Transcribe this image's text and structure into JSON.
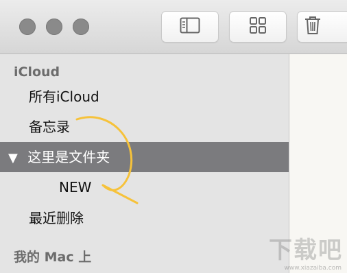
{
  "window": {
    "toolbar": {
      "sidebar_toggle_icon": "sidebar-icon",
      "gallery_icon": "grid-icon",
      "delete_icon": "trash-icon"
    }
  },
  "sidebar": {
    "icloud_section": "iCloud",
    "items": [
      {
        "label": "所有iCloud"
      },
      {
        "label": "备忘录"
      },
      {
        "label": "这里是文件夹",
        "disclosure": "▼",
        "selected": true
      },
      {
        "label": "NEW"
      },
      {
        "label": "最近删除"
      }
    ],
    "mac_section": "我的 Mac 上"
  },
  "watermark": {
    "text": "下载吧",
    "url": "www.xiazaiba.com"
  },
  "colors": {
    "selection": "#7b7b7e",
    "annotation": "#f6c23a",
    "traffic_light": "#8a8a8a"
  }
}
